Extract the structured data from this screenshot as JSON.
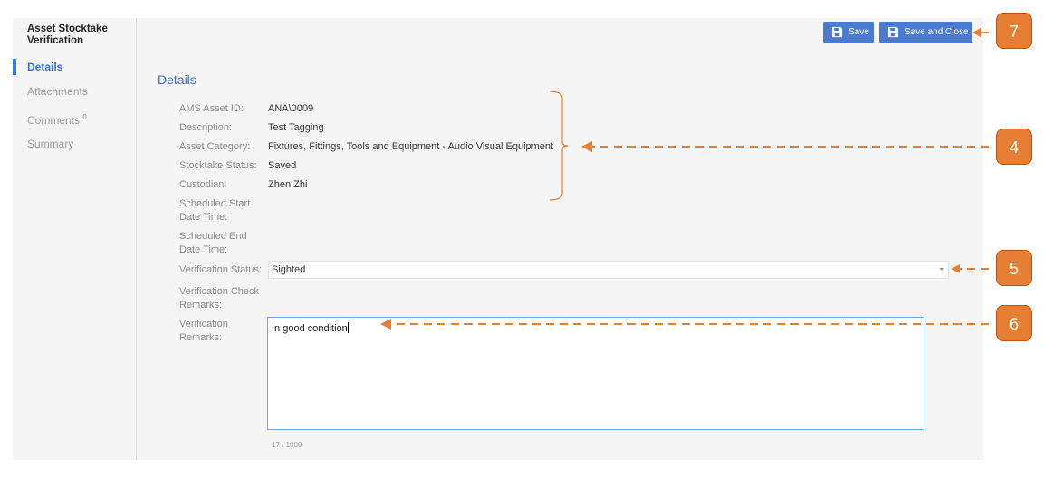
{
  "sidebar": {
    "title": "Asset Stocktake Verification",
    "items": [
      {
        "label": "Details",
        "active": true
      },
      {
        "label": "Attachments",
        "active": false
      },
      {
        "label": "Comments",
        "badge": "0",
        "active": false
      },
      {
        "label": "Summary",
        "active": false
      }
    ]
  },
  "toolbar": {
    "save_label": "Save",
    "save_close_label": "Save and Close",
    "button_color": "#4a7bd0"
  },
  "main": {
    "section_title": "Details",
    "fields": [
      {
        "label": "AMS Asset ID:",
        "value": "ANA\\0009"
      },
      {
        "label": "Description:",
        "value": "Test Tagging"
      },
      {
        "label": "Asset Category:",
        "value": "Fixtures, Fittings, Tools and Equipment - Audio Visual Equipment"
      },
      {
        "label": "Stocktake Status:",
        "value": "Saved"
      },
      {
        "label": "Custodian:",
        "value": "Zhen Zhi"
      },
      {
        "label": "Scheduled Start Date Time:",
        "value": ""
      },
      {
        "label": "Scheduled End Date Time:",
        "value": ""
      }
    ],
    "verification_status_label": "Verification Status:",
    "verification_status_value": "Sighted",
    "verification_check_remarks_label": "Verification Check Remarks:",
    "verification_remarks_label": "Verification Remarks:",
    "verification_remarks_value": "In good condition",
    "char_counter": "17 / 1000"
  },
  "annotations": {
    "color": "#e67e33",
    "callouts": [
      "4",
      "5",
      "6",
      "7"
    ]
  }
}
